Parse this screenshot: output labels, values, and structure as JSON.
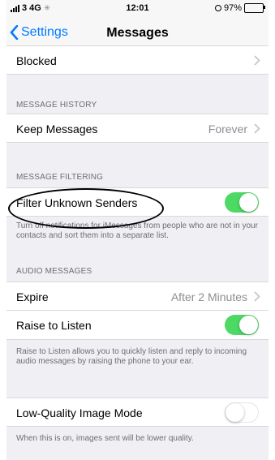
{
  "status_bar": {
    "carrier": "3",
    "network": "4G",
    "time": "12:01",
    "battery": "97%"
  },
  "nav": {
    "back_label": "Settings",
    "title": "Messages"
  },
  "rows": {
    "blocked": {
      "label": "Blocked"
    },
    "keep_messages": {
      "label": "Keep Messages",
      "value": "Forever"
    },
    "filter_unknown": {
      "label": "Filter Unknown Senders",
      "on": true
    },
    "expire": {
      "label": "Expire",
      "value": "After 2 Minutes"
    },
    "raise_to_listen": {
      "label": "Raise to Listen",
      "on": true
    },
    "low_quality": {
      "label": "Low-Quality Image Mode",
      "on": false
    }
  },
  "sections": {
    "message_history": "MESSAGE HISTORY",
    "message_filtering": "MESSAGE FILTERING",
    "audio_messages": "AUDIO MESSAGES"
  },
  "footers": {
    "filter": "Turn off notifications for iMessages from people who are not in your contacts and sort them into a separate list.",
    "raise": "Raise to Listen allows you to quickly listen and reply to incoming audio messages by raising the phone to your ear.",
    "low_quality": "When this is on, images sent will be lower quality."
  },
  "colors": {
    "accent": "#007aff",
    "toggle_on": "#4cd964",
    "background": "#efeff4"
  }
}
